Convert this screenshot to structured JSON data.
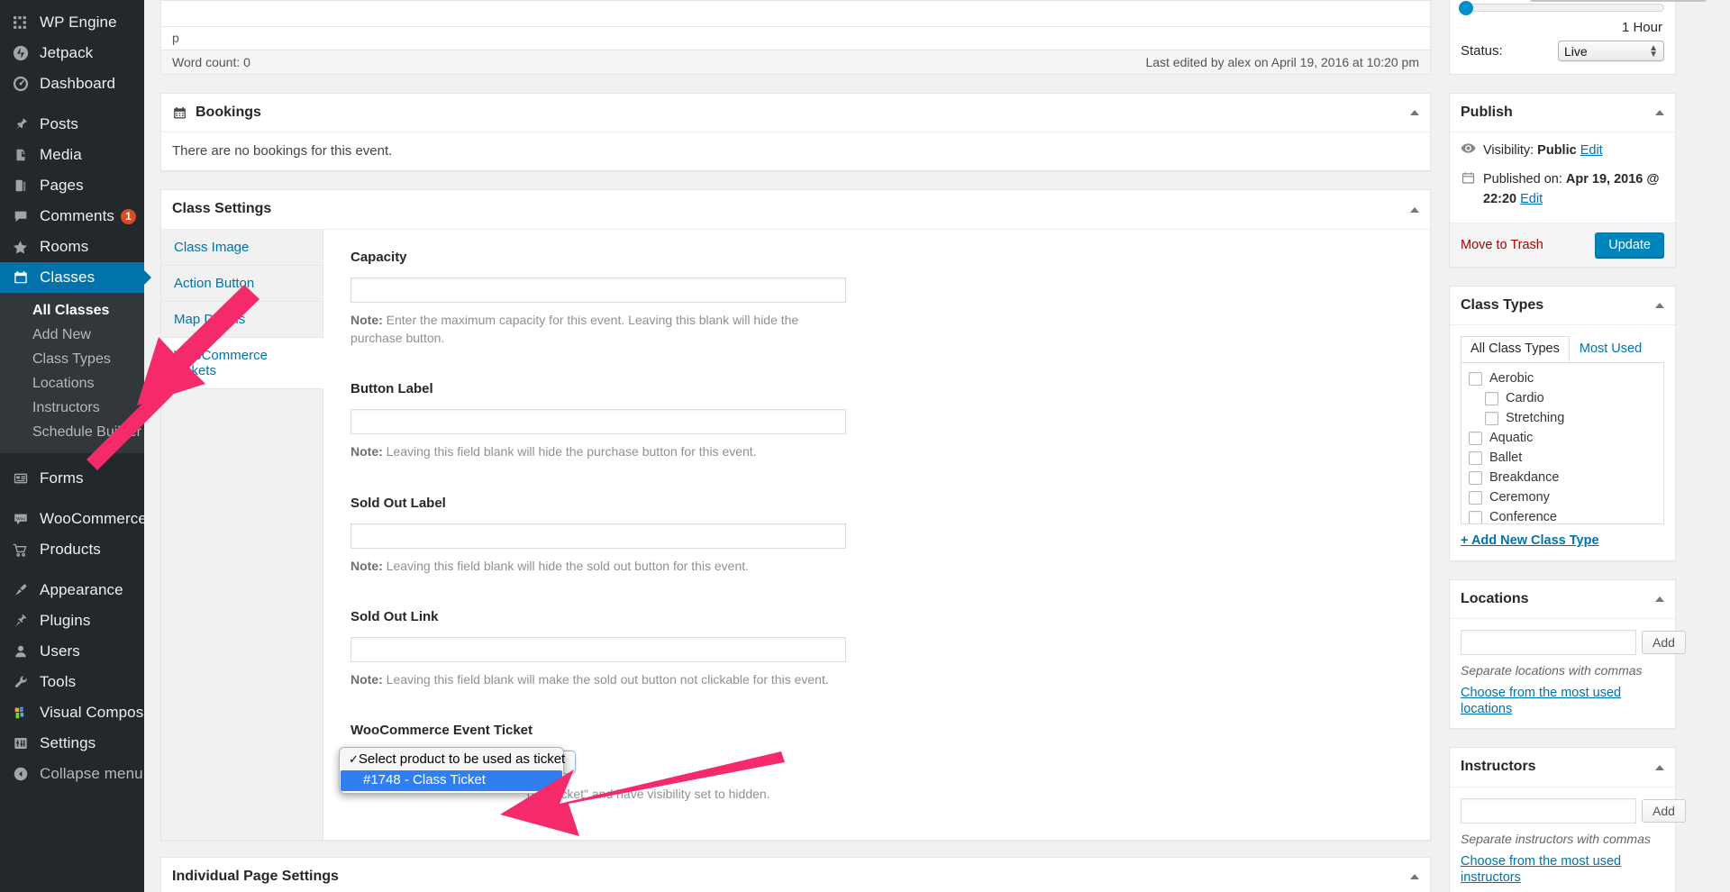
{
  "sidebar": {
    "items": [
      {
        "label": "WP Engine",
        "icon": "wp-engine-icon",
        "current": false
      },
      {
        "label": "Jetpack",
        "icon": "jetpack-icon",
        "current": false
      },
      {
        "label": "Dashboard",
        "icon": "dashboard-icon",
        "current": false
      },
      {
        "label": "Posts",
        "icon": "pin-icon",
        "current": false,
        "sep_before": true
      },
      {
        "label": "Media",
        "icon": "media-icon",
        "current": false
      },
      {
        "label": "Pages",
        "icon": "pages-icon",
        "current": false
      },
      {
        "label": "Comments",
        "icon": "comments-icon",
        "current": false,
        "badge": "1"
      },
      {
        "label": "Rooms",
        "icon": "star-icon",
        "current": false
      },
      {
        "label": "Classes",
        "icon": "calendar-icon",
        "current": true
      }
    ],
    "classes_submenu": [
      {
        "label": "All Classes",
        "current": true
      },
      {
        "label": "Add New",
        "current": false
      },
      {
        "label": "Class Types",
        "current": false
      },
      {
        "label": "Locations",
        "current": false
      },
      {
        "label": "Instructors",
        "current": false
      },
      {
        "label": "Schedule Builder",
        "current": false
      }
    ],
    "items_after": [
      {
        "label": "Forms",
        "icon": "forms-icon",
        "sep_before": true
      },
      {
        "label": "WooCommerce",
        "icon": "woocommerce-icon",
        "sep_before": true
      },
      {
        "label": "Products",
        "icon": "cart-icon"
      },
      {
        "label": "Appearance",
        "icon": "appearance-icon",
        "sep_before": true
      },
      {
        "label": "Plugins",
        "icon": "plugins-icon"
      },
      {
        "label": "Users",
        "icon": "users-icon"
      },
      {
        "label": "Tools",
        "icon": "tools-icon"
      },
      {
        "label": "Visual Composer",
        "icon": "visual-composer-icon"
      },
      {
        "label": "Settings",
        "icon": "settings-icon"
      }
    ],
    "collapse": {
      "label": "Collapse menu",
      "icon": "collapse-icon"
    }
  },
  "editor": {
    "path": "p",
    "word_count": "Word count: 0",
    "last_edited": "Last edited by alex on April 19, 2016 at 10:20 pm"
  },
  "bookings": {
    "title": "Bookings",
    "empty_text": "There are no bookings for this event."
  },
  "class_settings": {
    "title": "Class Settings",
    "tabs": [
      {
        "label": "Class Image",
        "active": false
      },
      {
        "label": "Action Button",
        "active": false
      },
      {
        "label": "Map Details",
        "active": false
      },
      {
        "label": "WooCommerce Tickets",
        "active": true
      }
    ],
    "fields": [
      {
        "label": "Capacity",
        "value": "",
        "note_prefix": "Note:",
        "note": " Enter the maximum capacity for this event. Leaving this blank will hide the purchase button."
      },
      {
        "label": "Button Label",
        "value": "",
        "note_prefix": "Note:",
        "note": " Leaving this field blank will hide the purchase button for this event."
      },
      {
        "label": "Sold Out Label",
        "value": "",
        "note_prefix": "Note:",
        "note": " Leaving this field blank will hide the sold out button for this event."
      },
      {
        "label": "Sold Out Link",
        "value": "",
        "note_prefix": "Note:",
        "note": " Leaving this field blank will make the sold out button not clickable for this event."
      }
    ],
    "ticket_field": {
      "label": "WooCommerce Event Ticket",
      "note_prefix": "Note:",
      "note_visible_tail": "dule ticket\" and have visibility set to hidden.",
      "options": [
        {
          "label": "Select product to be used as ticket",
          "checked": true,
          "highlighted": false
        },
        {
          "label": "#1748 - Class Ticket",
          "checked": false,
          "highlighted": true
        }
      ]
    }
  },
  "individual_page_settings": {
    "title": "Individual Page Settings"
  },
  "duration_box": {
    "value_label": "1 Hour",
    "status_label": "Status:",
    "status_value": "Live"
  },
  "publish": {
    "title": "Publish",
    "visibility_label": "Visibility:",
    "visibility_value": "Public",
    "visibility_edit": "Edit",
    "published_label": "Published on:",
    "published_value": "Apr 19, 2016 @ 22:20",
    "published_edit": "Edit",
    "trash_label": "Move to Trash",
    "update_label": "Update"
  },
  "class_types": {
    "title": "Class Types",
    "tabs": [
      {
        "label": "All Class Types",
        "active": true
      },
      {
        "label": "Most Used",
        "active": false
      }
    ],
    "items": [
      {
        "label": "Aerobic",
        "child": false,
        "checked": false
      },
      {
        "label": "Cardio",
        "child": true,
        "checked": false
      },
      {
        "label": "Stretching",
        "child": true,
        "checked": false
      },
      {
        "label": "Aquatic",
        "child": false,
        "checked": false
      },
      {
        "label": "Ballet",
        "child": false,
        "checked": false
      },
      {
        "label": "Breakdance",
        "child": false,
        "checked": false
      },
      {
        "label": "Ceremony",
        "child": false,
        "checked": false
      },
      {
        "label": "Conference",
        "child": false,
        "checked": false
      }
    ],
    "add_new": "+ Add New Class Type"
  },
  "locations": {
    "title": "Locations",
    "input_value": "",
    "add_label": "Add",
    "help": "Separate locations with commas",
    "choose_link": "Choose from the most used locations"
  },
  "instructors": {
    "title": "Instructors",
    "input_value": "",
    "add_label": "Add",
    "help": "Separate instructors with commas",
    "choose_link": "Choose from the most used instructors"
  },
  "annotations": {
    "arrow_color": "#f42a6b",
    "arrow_1_target": "WooCommerce Tickets",
    "arrow_2_target": "#1748 - Class Ticket"
  }
}
